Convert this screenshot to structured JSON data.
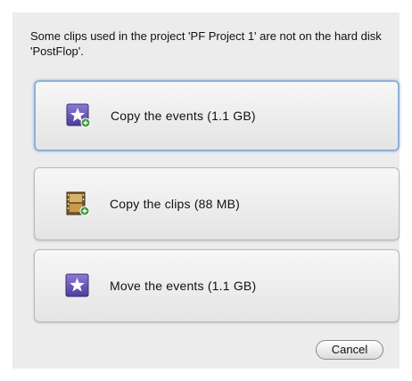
{
  "dialog": {
    "message": "Some clips used in the project 'PF Project 1' are not on the hard disk 'PostFlop'.",
    "options": [
      {
        "label": "Copy the events (1.1 GB)",
        "icon": "star-copy-icon",
        "selected": true
      },
      {
        "label": "Copy the clips (88 MB)",
        "icon": "film-clip-copy-icon",
        "selected": false
      },
      {
        "label": "Move the events (1.1 GB)",
        "icon": "star-icon",
        "selected": false
      }
    ],
    "cancel_label": "Cancel"
  },
  "colors": {
    "dialog_bg": "#ececec",
    "selected_border": "#8fb0d8",
    "star_purple": "#6a57b7",
    "green_badge": "#3f9a3a"
  }
}
